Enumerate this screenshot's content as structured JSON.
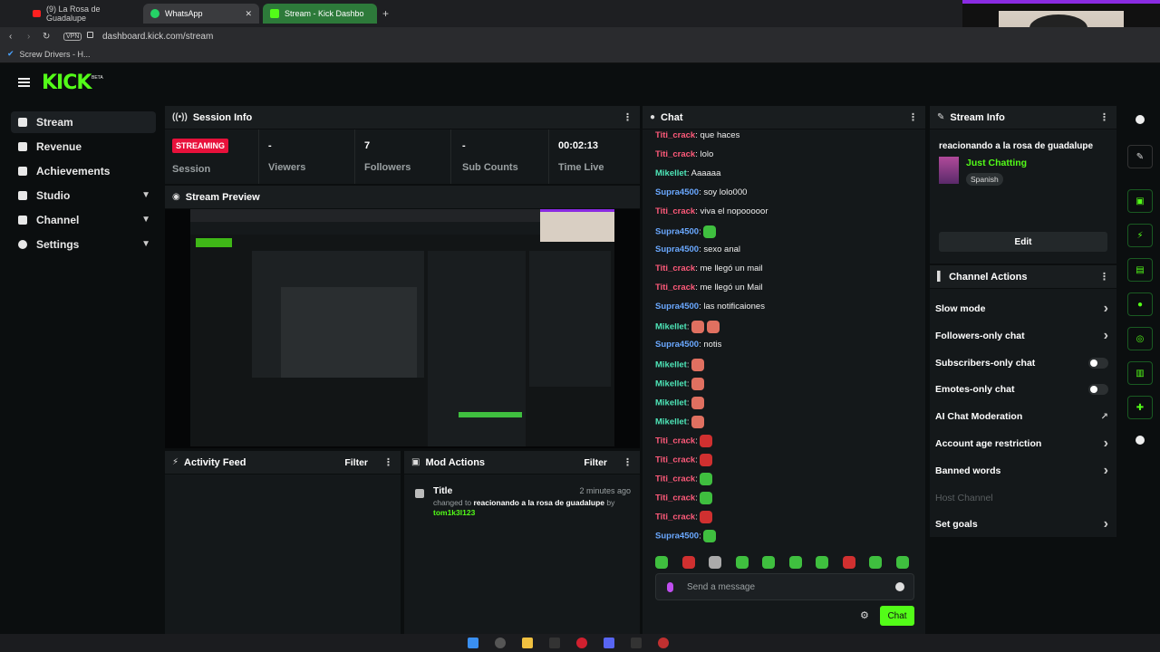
{
  "browser": {
    "tabs": [
      {
        "title": "(9) La Rosa de Guadalupe"
      },
      {
        "title": "WhatsApp"
      },
      {
        "title": "Stream - Kick Dashbo"
      }
    ],
    "vpn": "VPN",
    "url": "dashboard.kick.com/stream",
    "bookmark": "Screw Drivers - H..."
  },
  "brand": {
    "logo": "KICK",
    "badge": "BETA",
    "accent": "#53fc18"
  },
  "nav": [
    {
      "label": "Stream",
      "selected": true
    },
    {
      "label": "Revenue"
    },
    {
      "label": "Achievements"
    },
    {
      "label": "Studio",
      "expandable": true
    },
    {
      "label": "Channel",
      "expandable": true
    },
    {
      "label": "Settings",
      "expandable": true
    }
  ],
  "session": {
    "title": "Session Info",
    "badge": "STREAMING",
    "session_label": "Session",
    "viewers_value": "-",
    "viewers_label": "Viewers",
    "followers_value": "7",
    "followers_label": "Followers",
    "subs_value": "-",
    "subs_label": "Sub Counts",
    "time_value": "00:02:13",
    "time_label": "Time Live"
  },
  "preview": {
    "title": "Stream Preview"
  },
  "activity": {
    "title": "Activity Feed",
    "filter": "Filter"
  },
  "mod": {
    "title": "Mod Actions",
    "filter": "Filter",
    "entry_title": "Title",
    "entry_time": "2 minutes ago",
    "entry_prefix": "changed to",
    "entry_value": "reacionando a la rosa de guadalupe",
    "entry_by": "by",
    "entry_user": "tom1k3l123"
  },
  "chat": {
    "title": "Chat",
    "messages": [
      {
        "user": "Titi_crack",
        "text": "que haces",
        "color": "#ff5a7a"
      },
      {
        "user": "Titi_crack",
        "text": "lolo",
        "color": "#ff5a7a"
      },
      {
        "user": "Mikellet",
        "text": "Aaaaaa",
        "color": "#4ee6b8"
      },
      {
        "user": "Supra4500",
        "text": "soy lolo000",
        "color": "#6aa8ff"
      },
      {
        "user": "Titi_crack",
        "text": "viva el nopooooor",
        "color": "#ff5a7a"
      },
      {
        "user": "Supra4500",
        "text": "",
        "emotes": [
          "#3fbf3f"
        ],
        "color": "#6aa8ff"
      },
      {
        "user": "Supra4500",
        "text": "sexo anal",
        "color": "#6aa8ff"
      },
      {
        "user": "Titi_crack",
        "text": "me llegó un mail",
        "color": "#ff5a7a"
      },
      {
        "user": "Titi_crack",
        "text": "me llegó un Mail",
        "color": "#ff5a7a"
      },
      {
        "user": "Supra4500",
        "text": "las notificaiones",
        "color": "#6aa8ff"
      },
      {
        "user": "Mikellet",
        "text": "",
        "emotes": [
          "#e07060",
          "#e07060"
        ],
        "color": "#4ee6b8"
      },
      {
        "user": "Supra4500",
        "text": "notis",
        "color": "#6aa8ff"
      },
      {
        "user": "Mikellet",
        "text": "",
        "emotes": [
          "#e07060"
        ],
        "color": "#4ee6b8"
      },
      {
        "user": "Mikellet",
        "text": "",
        "emotes": [
          "#e07060"
        ],
        "color": "#4ee6b8"
      },
      {
        "user": "Mikellet",
        "text": "",
        "emotes": [
          "#e07060"
        ],
        "color": "#4ee6b8"
      },
      {
        "user": "Mikellet",
        "text": "",
        "emotes": [
          "#e07060"
        ],
        "color": "#4ee6b8"
      },
      {
        "user": "Titi_crack",
        "text": "",
        "emotes": [
          "#d03030"
        ],
        "color": "#ff5a7a"
      },
      {
        "user": "Titi_crack",
        "text": "",
        "emotes": [
          "#d03030"
        ],
        "color": "#ff5a7a"
      },
      {
        "user": "Titi_crack",
        "text": "",
        "emotes": [
          "#3fbf3f"
        ],
        "color": "#ff5a7a"
      },
      {
        "user": "Titi_crack",
        "text": "",
        "emotes": [
          "#3fbf3f"
        ],
        "color": "#ff5a7a"
      },
      {
        "user": "Titi_crack",
        "text": "",
        "emotes": [
          "#d03030"
        ],
        "color": "#ff5a7a"
      },
      {
        "user": "Supra4500",
        "text": "",
        "emotes": [
          "#3fbf3f"
        ],
        "color": "#6aa8ff"
      }
    ],
    "emote_bar": [
      "#3fbf3f",
      "#d03030",
      "#aaaaaa",
      "#3fbf3f",
      "#3fbf3f",
      "#3fbf3f",
      "#3fbf3f",
      "#d03030",
      "#3fbf3f",
      "#3fbf3f"
    ],
    "placeholder": "Send a message",
    "send_label": "Chat"
  },
  "stream_info": {
    "title": "Stream Info",
    "stream_title": "reacionando a la rosa de guadalupe",
    "category": "Just Chatting",
    "language": "Spanish",
    "edit": "Edit"
  },
  "channel_actions": {
    "title": "Channel Actions",
    "items": [
      {
        "label": "Slow mode",
        "control": "arrow"
      },
      {
        "label": "Followers-only chat",
        "control": "arrow"
      },
      {
        "label": "Subscribers-only chat",
        "control": "toggle"
      },
      {
        "label": "Emotes-only chat",
        "control": "toggle"
      },
      {
        "label": "AI Chat Moderation",
        "control": "external"
      },
      {
        "label": "Account age restriction",
        "control": "arrow"
      },
      {
        "label": "Banned words",
        "control": "arrow"
      },
      {
        "label": "Host Channel",
        "control": "none",
        "disabled": true
      },
      {
        "label": "Set goals",
        "control": "arrow"
      }
    ]
  }
}
